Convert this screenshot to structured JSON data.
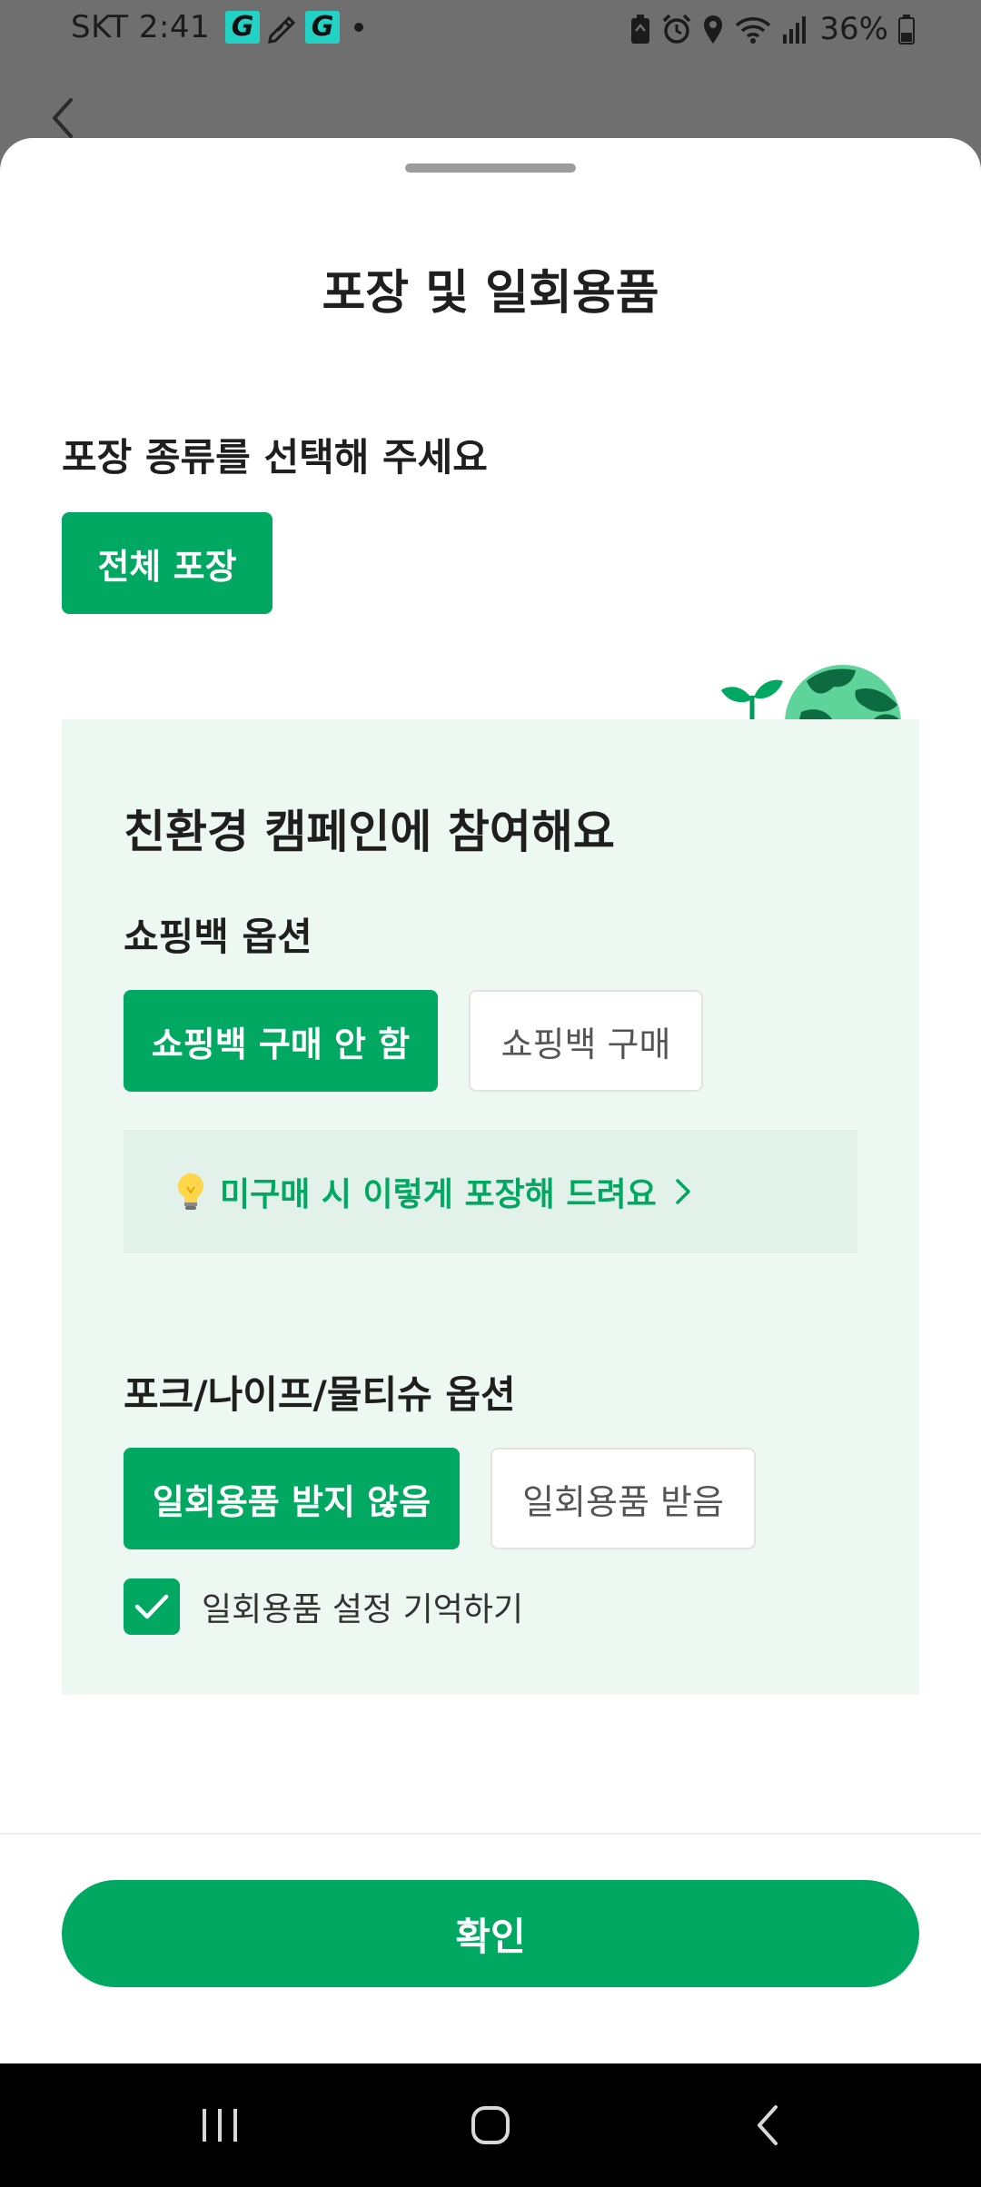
{
  "status_bar": {
    "carrier": "SKT",
    "time": "2:41",
    "app_icon_letter": "G",
    "battery": "36%",
    "icons": [
      "g-app-icon",
      "pen-icon",
      "g-app-icon",
      "notification-dot",
      "battery-saver-icon",
      "alarm-icon",
      "location-icon",
      "wifi-icon",
      "signal-icon",
      "battery-icon"
    ]
  },
  "header": {
    "back_icon": "chevron-left-icon"
  },
  "sheet": {
    "title": "포장 및 일회용품",
    "packaging": {
      "label": "포장 종류를 선택해 주세요",
      "options": [
        {
          "label": "전체 포장",
          "selected": true
        }
      ]
    },
    "eco": {
      "title": "친환경 캠페인에 참여해요",
      "illustration": "earth-sprout-illustration",
      "bag": {
        "label": "쇼핑백 옵션",
        "options": [
          {
            "label": "쇼핑백 구매 안 함",
            "selected": true
          },
          {
            "label": "쇼핑백 구매",
            "selected": false
          }
        ]
      },
      "tip": {
        "icon": "lightbulb-icon",
        "text": "미구매 시 이렇게 포장해 드려요"
      },
      "cutlery": {
        "label": "포크/나이프/물티슈 옵션",
        "options": [
          {
            "label": "일회용품 받지 않음",
            "selected": true
          },
          {
            "label": "일회용품 받음",
            "selected": false
          }
        ]
      },
      "remember": {
        "label": "일회용품 설정 기억하기",
        "checked": true
      }
    },
    "confirm_label": "확인"
  },
  "nav_bar": {
    "buttons": [
      "recent-apps",
      "home",
      "back"
    ]
  },
  "colors": {
    "accent": "#00a862",
    "eco_bg": "#eef8f3",
    "tip_bg": "#e2f2ea",
    "overlay": "#6f6f6f"
  }
}
